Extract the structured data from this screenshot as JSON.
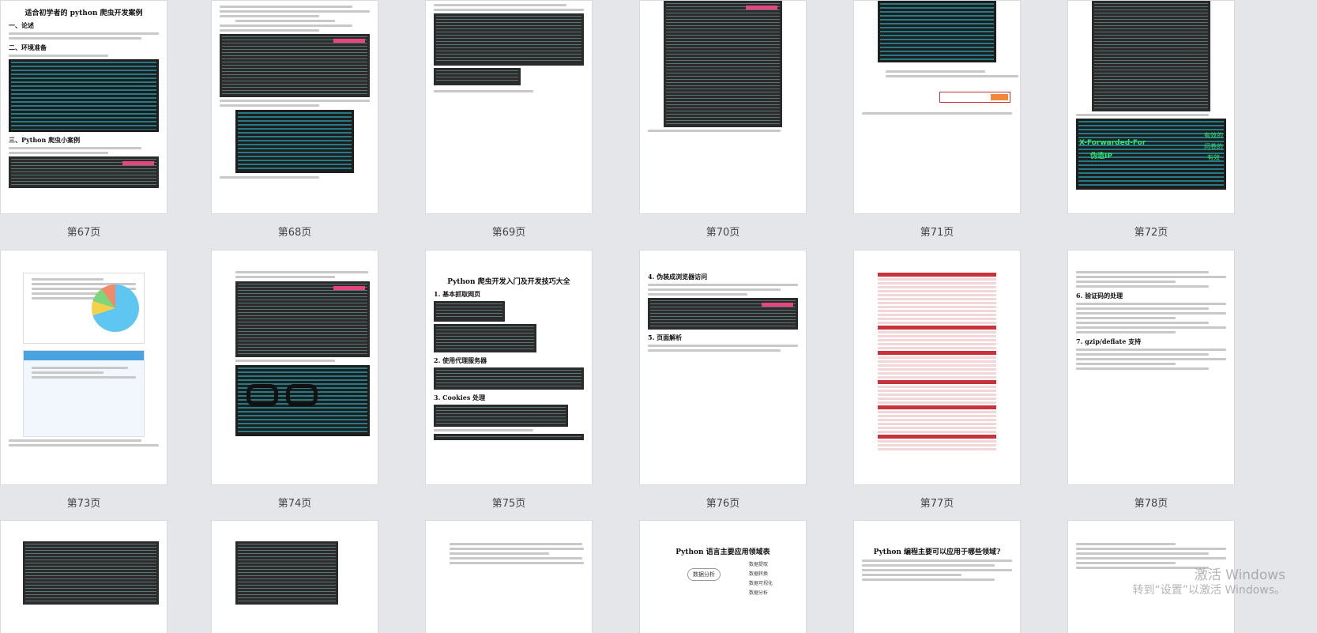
{
  "pages": [
    {
      "label": "第67页",
      "title": "适合初学者的 python 爬虫开发案例",
      "headings": [
        "一、论述",
        "二、环境准备",
        "三、Python 爬虫小案例"
      ]
    },
    {
      "label": "第68页"
    },
    {
      "label": "第69页"
    },
    {
      "label": "第70页"
    },
    {
      "label": "第71页"
    },
    {
      "label": "第72页",
      "overlay_lines": [
        "X-Forwarded-For",
        "伪造IP",
        "有效的",
        "问卷的",
        "有效"
      ]
    },
    {
      "label": "第73页"
    },
    {
      "label": "第74页"
    },
    {
      "label": "第75页",
      "title": "Python 爬虫开发入门及开发技巧大全",
      "headings": [
        "1. 基本抓取网页",
        "2. 使用代理服务器",
        "3. Cookies 处理"
      ]
    },
    {
      "label": "第76页",
      "headings": [
        "4. 伪装成浏览器访问",
        "5. 页面解析"
      ]
    },
    {
      "label": "第77页"
    },
    {
      "label": "第78页",
      "headings": [
        "6. 验证码的处理",
        "7. gzip/deflate 支持"
      ]
    },
    {
      "label": ""
    },
    {
      "label": ""
    },
    {
      "label": ""
    },
    {
      "label": "",
      "title": "Python 语言主要应用领域表",
      "mindmap": {
        "center": "数据分析",
        "leaves": [
          "数据提取",
          "数据转换",
          "数据可视化",
          "数据分析"
        ]
      }
    },
    {
      "label": "",
      "title": "Python 编程主要可以应用于哪些领域?"
    },
    {
      "label": ""
    }
  ],
  "watermark": {
    "line1": "激活 Windows",
    "line2": "转到“设置”以激活 Windows。"
  },
  "colors": {
    "background": "#e4e6ea",
    "code_bg": "#2b2b2b",
    "highlight_pink": "#e8457f",
    "table_red": "#c8333b"
  }
}
